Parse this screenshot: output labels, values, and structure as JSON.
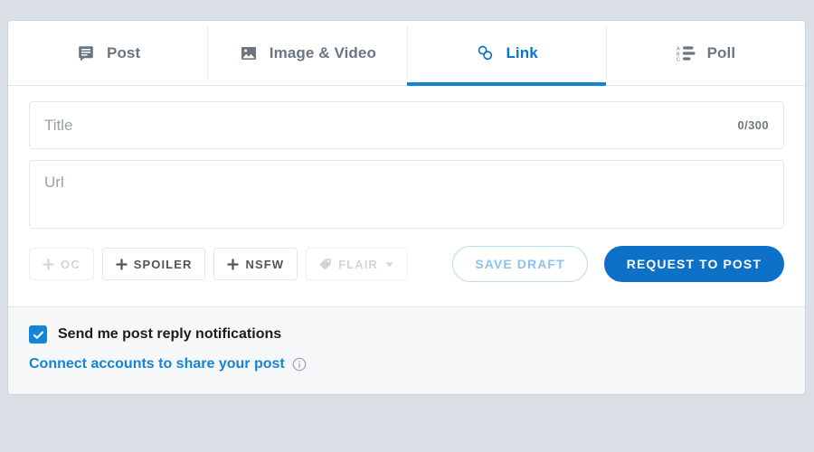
{
  "tabs": [
    {
      "label": "Post",
      "icon": "post-icon",
      "active": false
    },
    {
      "label": "Image & Video",
      "icon": "image-video-icon",
      "active": false
    },
    {
      "label": "Link",
      "icon": "link-icon",
      "active": true
    },
    {
      "label": "Poll",
      "icon": "poll-icon",
      "active": false
    }
  ],
  "form": {
    "title": {
      "placeholder": "Title",
      "value": "",
      "counter": "0/300"
    },
    "url": {
      "placeholder": "Url",
      "value": ""
    }
  },
  "tag_buttons": [
    {
      "label": "OC",
      "icon": "plus-icon",
      "disabled": true
    },
    {
      "label": "SPOILER",
      "icon": "plus-icon",
      "disabled": false
    },
    {
      "label": "NSFW",
      "icon": "plus-icon",
      "disabled": false
    },
    {
      "label": "FLAIR",
      "icon": "tag-icon",
      "disabled": true,
      "chevron": "chevron-down-icon"
    }
  ],
  "actions": {
    "save_draft_label": "SAVE DRAFT",
    "request_to_post_label": "REQUEST TO POST"
  },
  "footer": {
    "notifications_label": "Send me post reply notifications",
    "notifications_checked": true,
    "connect_link_label": "Connect accounts to share your post",
    "info_icon": "info-icon"
  },
  "colors": {
    "page_background": "#dae0e6",
    "accent_blue": "#1484d6",
    "primary_button": "#0c71c7",
    "footer_background": "#f6f7f8",
    "muted_text": "#6b7680",
    "disabled_text": "#cfd6db"
  }
}
